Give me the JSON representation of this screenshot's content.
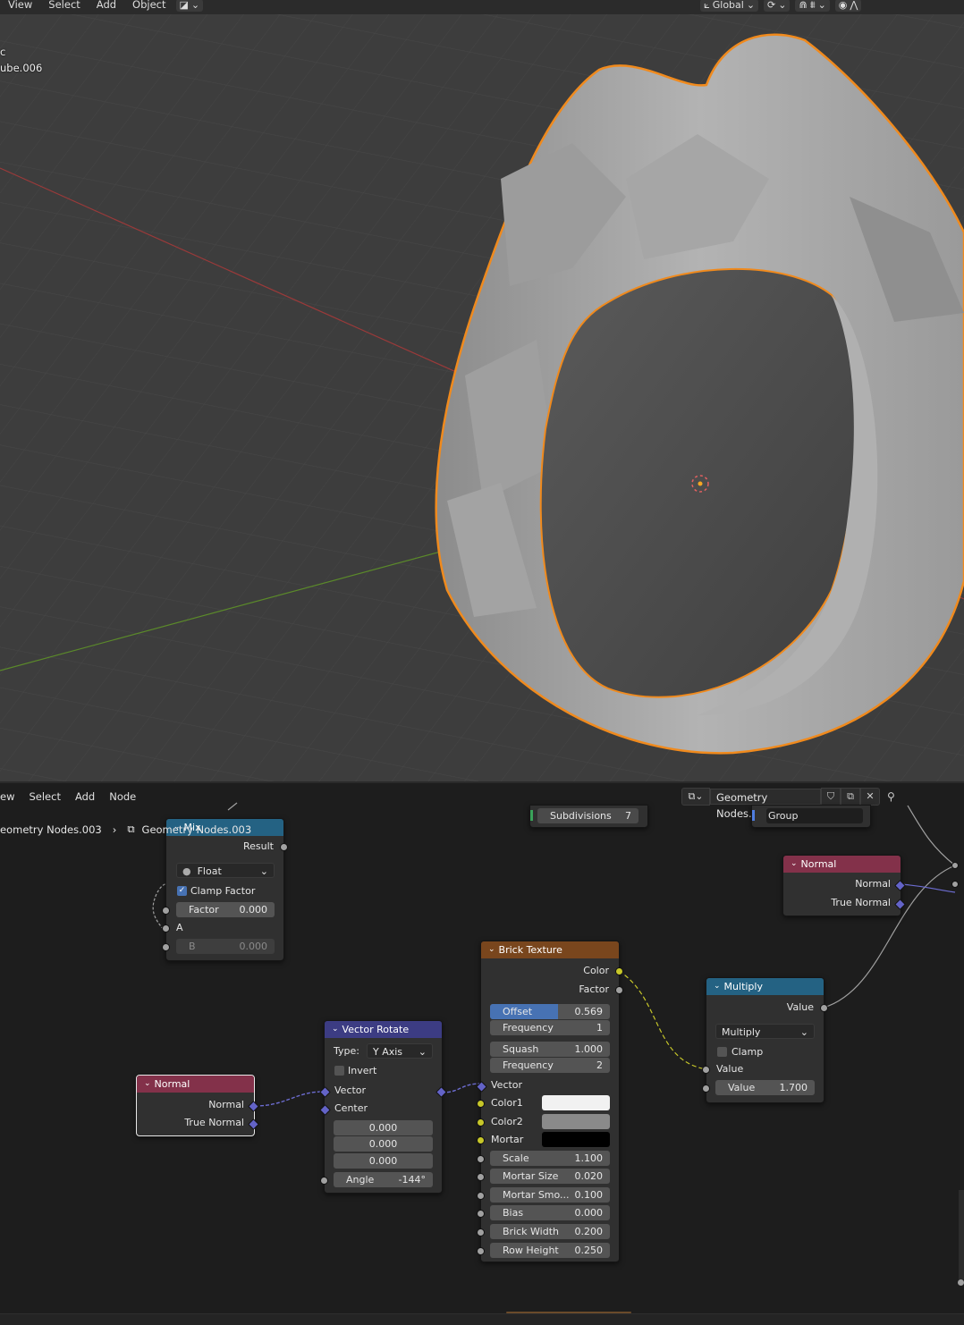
{
  "viewport": {
    "menu": [
      "View",
      "Select",
      "Add",
      "Object"
    ],
    "orientation": "Global",
    "object_info": {
      "line1": "c",
      "line2": "ube.006"
    }
  },
  "node_editor": {
    "menu": [
      "ew",
      "Select",
      "Add",
      "Node"
    ],
    "tree_name": "Geometry Nodes.003",
    "breadcrumb": {
      "parent": "eometry Nodes.003",
      "child": "Geometry Nodes.003"
    },
    "partial_nodes": {
      "subdivisions_label": "Subdivisions",
      "subdivisions_value": "7",
      "group_label": "Group"
    }
  },
  "nodes": {
    "mix": {
      "title": "Mix",
      "output": "Result",
      "data_type": "Float",
      "clamp_label": "Clamp Factor",
      "clamp_checked": true,
      "factor_label": "Factor",
      "factor_value": "0.000",
      "a_label": "A",
      "b_label": "B",
      "b_value": "0.000"
    },
    "normal_right": {
      "title": "Normal",
      "out1": "Normal",
      "out2": "True Normal"
    },
    "normal_left": {
      "title": "Normal",
      "out1": "Normal",
      "out2": "True Normal"
    },
    "brick": {
      "title": "Brick Texture",
      "out1": "Color",
      "out2": "Factor",
      "offset_label": "Offset",
      "offset_value": "0.569",
      "offset_fraction": 0.569,
      "freq1_label": "Frequency",
      "freq1_value": "1",
      "squash_label": "Squash",
      "squash_value": "1.000",
      "freq2_label": "Frequency",
      "freq2_value": "2",
      "vector_label": "Vector",
      "color1_label": "Color1",
      "color1": "#f1f1f1",
      "color2_label": "Color2",
      "color2": "#8a8a8a",
      "mortar_label": "Mortar",
      "mortar": "#000000",
      "scale_label": "Scale",
      "scale_value": "1.100",
      "mortar_size_label": "Mortar Size",
      "mortar_size_value": "0.020",
      "mortar_smooth_label": "Mortar Smo...",
      "mortar_smooth_value": "0.100",
      "bias_label": "Bias",
      "bias_value": "0.000",
      "brick_width_label": "Brick Width",
      "brick_width_value": "0.200",
      "row_height_label": "Row Height",
      "row_height_value": "0.250"
    },
    "vector_rotate": {
      "title": "Vector Rotate",
      "type_label": "Type:",
      "type_value": "Y Axis",
      "invert_label": "Invert",
      "vector_label": "Vector",
      "center_label": "Center",
      "c1": "0.000",
      "c2": "0.000",
      "c3": "0.000",
      "angle_label": "Angle",
      "angle_value": "-144°"
    },
    "multiply": {
      "title": "Multiply",
      "out": "Value",
      "op": "Multiply",
      "clamp_label": "Clamp",
      "value_label": "Value",
      "value_field_label": "Value",
      "value_field_value": "1.700"
    }
  },
  "colors": {
    "converter": "#246283",
    "input": "#83314a",
    "texture": "#79461d",
    "vector": "#3c3c83",
    "selection": "#f5a623",
    "axis_x": "#b03a3a",
    "axis_y": "#6a9a2a"
  }
}
